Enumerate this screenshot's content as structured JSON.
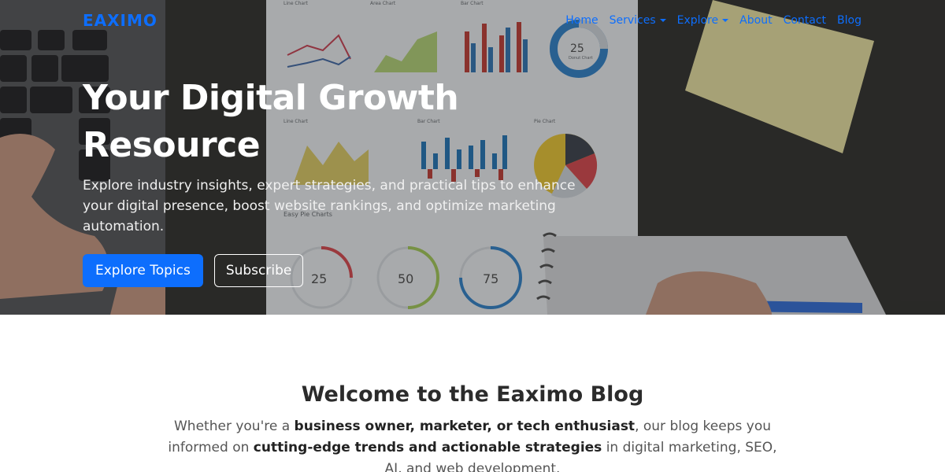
{
  "nav": {
    "brand": "EAXIMO",
    "links": [
      {
        "label": "Home"
      },
      {
        "label": "Services",
        "dropdown": true
      },
      {
        "label": "Explore",
        "dropdown": true
      },
      {
        "label": "About"
      },
      {
        "label": "Contact"
      },
      {
        "label": "Blog"
      }
    ]
  },
  "hero": {
    "title": "Your Digital Growth Resource",
    "subtitle": "Explore industry insights, expert strategies, and practical tips to enhance your digital presence, boost website rankings, and optimize marketing automation.",
    "primary_button": "Explore Topics",
    "secondary_button": "Subscribe",
    "background_texts": {
      "line_chart": "Line Chart",
      "area_chart": "Area Chart",
      "bar_chart": "Bar Chart",
      "donut_chart": "Donut Chart",
      "pie_chart": "Pie Chart",
      "easy_pie": "Easy Pie Charts",
      "donut_value": "25",
      "pie_values": [
        "25",
        "50",
        "75"
      ],
      "percent": "%"
    }
  },
  "welcome": {
    "title": "Welcome to the Eaximo Blog",
    "text_1": "Whether you're a ",
    "bold_1": "business owner, marketer, or tech enthusiast",
    "text_2": ", our blog keeps you informed on ",
    "bold_2": "cutting-edge trends and actionable strategies",
    "text_3": " in digital marketing, SEO, AI, and web development."
  },
  "colors": {
    "accent": "#0d6efd",
    "hero_bg": "#3b3a39"
  }
}
